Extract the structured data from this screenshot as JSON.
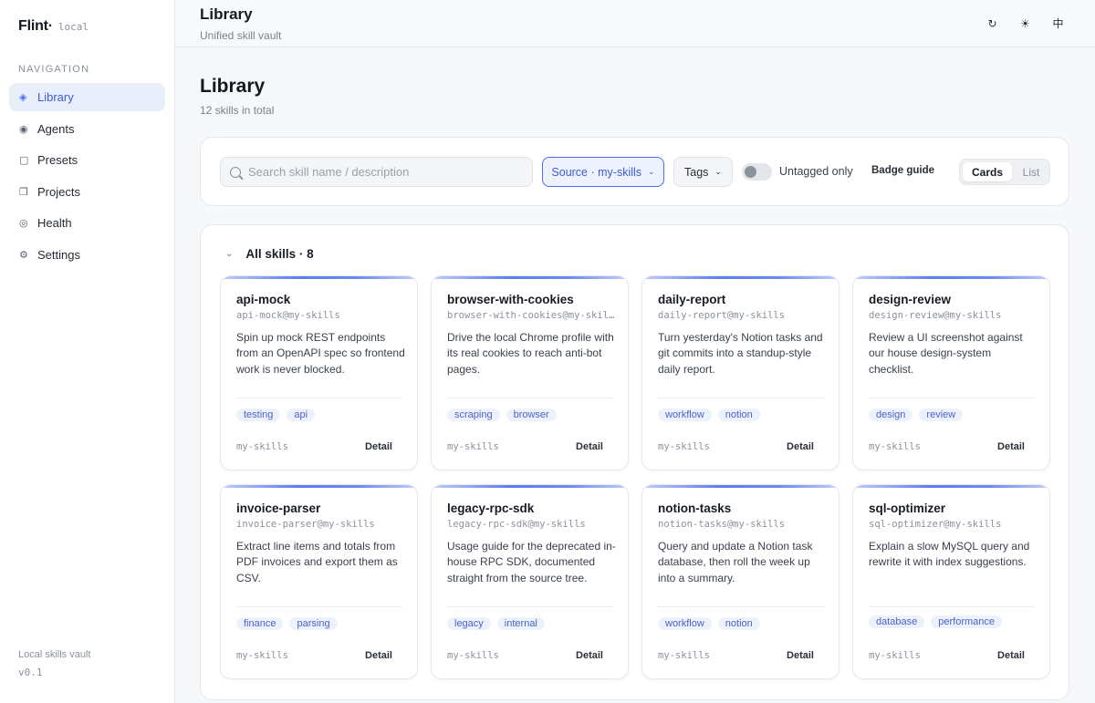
{
  "sidebar": {
    "brand": "Flint·",
    "brand_tag": "local",
    "nav_heading": "NAVIGATION",
    "items": [
      {
        "label": "Library",
        "icon": "◈"
      },
      {
        "label": "Agents",
        "icon": "◉"
      },
      {
        "label": "Presets",
        "icon": "▢"
      },
      {
        "label": "Projects",
        "icon": "❐"
      },
      {
        "label": "Health",
        "icon": "◎"
      },
      {
        "label": "Settings",
        "icon": "⚙"
      }
    ],
    "footer_title": "Local skills vault",
    "version": "v0.1"
  },
  "topbar": {
    "title": "Library",
    "subtitle": "Unified skill vault",
    "icons": {
      "refresh": "↻",
      "theme": "☀",
      "language": "中"
    }
  },
  "main": {
    "title": "Library",
    "count": "12 skills in total"
  },
  "filters": {
    "search_placeholder": "Search skill name / description",
    "source_label": "Source · my-skills",
    "tags_label": "Tags",
    "untagged_label": "Untagged only",
    "untagged_on": false,
    "badge_guide": "Badge guide",
    "view_cards": "Cards",
    "view_list": "List"
  },
  "section": {
    "title": "All skills · 8"
  },
  "accent_color": "#4c6ef5",
  "cards": [
    {
      "name": "api-mock",
      "id": "api-mock@my-skills",
      "desc": "Spin up mock REST endpoints from an OpenAPI spec so frontend work is never blocked.",
      "tags": [
        "testing",
        "api"
      ],
      "source": "my-skills",
      "detail": "Detail"
    },
    {
      "name": "browser-with-cookies",
      "id": "browser-with-cookies@my-skil…",
      "desc": "Drive the local Chrome profile with its real cookies to reach anti-bot pages.",
      "tags": [
        "scraping",
        "browser"
      ],
      "source": "my-skills",
      "detail": "Detail"
    },
    {
      "name": "daily-report",
      "id": "daily-report@my-skills",
      "desc": "Turn yesterday's Notion tasks and git commits into a standup-style daily report.",
      "tags": [
        "workflow",
        "notion"
      ],
      "source": "my-skills",
      "detail": "Detail"
    },
    {
      "name": "design-review",
      "id": "design-review@my-skills",
      "desc": "Review a UI screenshot against our house design-system checklist.",
      "tags": [
        "design",
        "review"
      ],
      "source": "my-skills",
      "detail": "Detail"
    },
    {
      "name": "invoice-parser",
      "id": "invoice-parser@my-skills",
      "desc": "Extract line items and totals from PDF invoices and export them as CSV.",
      "tags": [
        "finance",
        "parsing"
      ],
      "source": "my-skills",
      "detail": "Detail"
    },
    {
      "name": "legacy-rpc-sdk",
      "id": "legacy-rpc-sdk@my-skills",
      "desc": "Usage guide for the deprecated in-house RPC SDK, documented straight from the source tree.",
      "tags": [
        "legacy",
        "internal"
      ],
      "source": "my-skills",
      "detail": "Detail"
    },
    {
      "name": "notion-tasks",
      "id": "notion-tasks@my-skills",
      "desc": "Query and update a Notion task database, then roll the week up into a summary.",
      "tags": [
        "workflow",
        "notion"
      ],
      "source": "my-skills",
      "detail": "Detail"
    },
    {
      "name": "sql-optimizer",
      "id": "sql-optimizer@my-skills",
      "desc": "Explain a slow MySQL query and rewrite it with index suggestions.",
      "tags": [
        "database",
        "performance"
      ],
      "source": "my-skills",
      "detail": "Detail"
    }
  ]
}
